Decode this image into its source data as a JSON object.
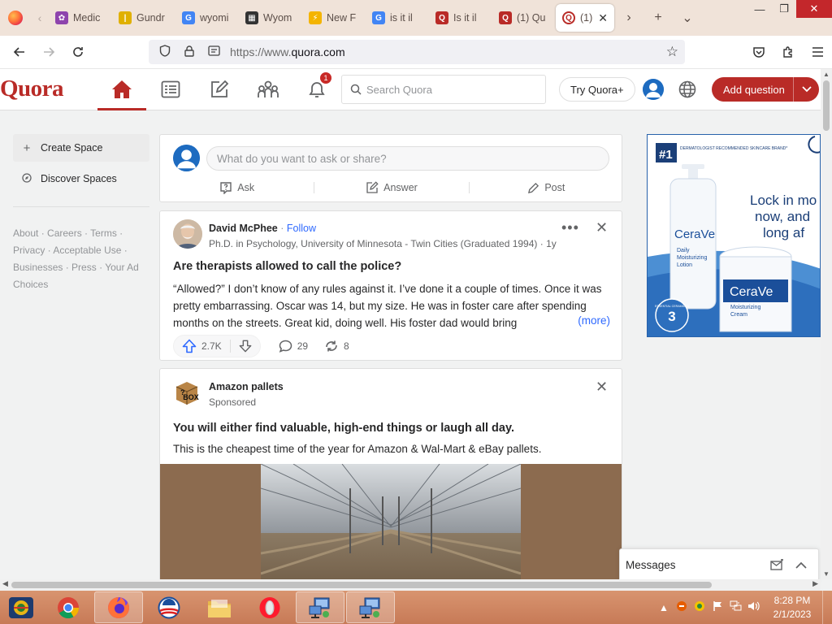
{
  "browser": {
    "tabs": [
      {
        "label": "Medic",
        "fav_bg": "#8e44ad",
        "fav": "✿"
      },
      {
        "label": "Gundr",
        "fav_bg": "#e0b000",
        "fav": "|"
      },
      {
        "label": "wyomi",
        "fav_bg": "#4285f4",
        "fav": "G"
      },
      {
        "label": "Wyom",
        "fav_bg": "#333333",
        "fav": "▦"
      },
      {
        "label": "New F",
        "fav_bg": "#f4b400",
        "fav": "⚡"
      },
      {
        "label": "is it il",
        "fav_bg": "#4285f4",
        "fav": "G"
      },
      {
        "label": "Is it il",
        "fav_bg": "#b92b27",
        "fav": "Q"
      },
      {
        "label": "(1) Qu",
        "fav_bg": "#b92b27",
        "fav": "Q"
      }
    ],
    "active_tab": {
      "label": "(1)",
      "fav": "Q"
    },
    "url_prefix": "https://www.",
    "url_domain": "quora.com"
  },
  "quora": {
    "logo": "Quora",
    "notification_count": "1",
    "search_placeholder": "Search Quora",
    "try_plus": "Try Quora+",
    "add_question": "Add question"
  },
  "sidebar": {
    "create_space": "Create Space",
    "discover_spaces": "Discover Spaces",
    "footer_links": [
      "About",
      "Careers",
      "Terms",
      "Privacy",
      "Acceptable Use",
      "Businesses",
      "Press",
      "Your Ad Choices"
    ]
  },
  "ask_box": {
    "placeholder": "What do you want to ask or share?",
    "ask": "Ask",
    "answer": "Answer",
    "post": "Post"
  },
  "post": {
    "author": "David McPhee",
    "follow": "Follow",
    "credential": "Ph.D. in Psychology, University of Minnesota - Twin Cities (Graduated 1994) · 1y",
    "question": "Are therapists allowed to call the police?",
    "body": "“Allowed?” I don’t know of any rules against it. I’ve done it a couple of times. Once it was pretty embarrassing. Oscar was 14, but my size. He was in foster care after spending months on the streets. Great kid, doing well. His foster dad would bring",
    "more": "(more)",
    "upvotes": "2.7K",
    "comments": "29",
    "shares": "8"
  },
  "sponsored": {
    "name": "Amazon pallets",
    "label": "Sponsored",
    "title": "You will either find valuable, high-end things or laugh all day.",
    "text": "This is the cheapest time of the year for Amazon & Wal-Mart & eBay pallets."
  },
  "side_ad": {
    "badge": "#1",
    "badge_text": "DERMATOLOGIST RECOMMENDED SKINCARE BRAND*",
    "headline_1": "Lock in mo",
    "headline_2": "now, and",
    "headline_3": "long af",
    "brand": "CeraVe",
    "product_1_a": "Daily",
    "product_1_b": "Moisturizing",
    "product_1_c": "Lotion",
    "product_2_a": "Moisturizing",
    "product_2_b": "Cream",
    "essential": "3",
    "essential_text": "ESSENTIAL CERAMIDES"
  },
  "messages": {
    "label": "Messages"
  },
  "taskbar": {
    "time": "8:28 PM",
    "date": "2/1/2023"
  },
  "colors": {
    "accent": "#b92b27",
    "link": "#2e69ff"
  }
}
